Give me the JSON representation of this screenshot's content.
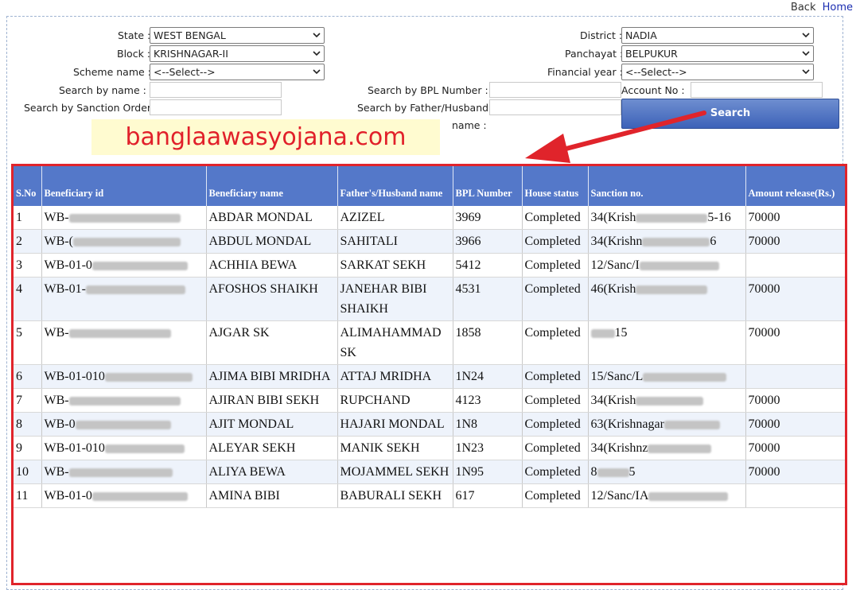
{
  "nav": {
    "back": "Back",
    "home": "Home"
  },
  "filters": {
    "state_label": "State :",
    "state_value": "WEST BENGAL",
    "block_label": "Block :",
    "block_value": "KRISHNAGAR-II",
    "scheme_label": "Scheme name :",
    "scheme_value": "<--Select-->",
    "search_name_label": "Search by name :",
    "search_sanction_label": "Search by Sanction Order",
    "district_label": "District :",
    "district_value": "NADIA",
    "panchayat_label": "Panchayat :",
    "panchayat_value": "BELPUKUR",
    "fy_label": "Financial year :",
    "fy_value": "<--Select-->",
    "bpl_label": "Search by BPL Number :",
    "father_label_1": "Search by Father/Husband",
    "father_label_2": "name :",
    "account_label": "Account No :",
    "search_button": "Search"
  },
  "watermark": "banglaawasyojana.com",
  "table": {
    "headers": [
      "S.No",
      "Beneficiary id",
      "Beneficiary name",
      "Father's/Husband name",
      "BPL Number",
      "House status",
      "Sanction no.",
      "Amount release(Rs.)"
    ],
    "rows": [
      {
        "sno": "1",
        "id": "WB-",
        "name": "ABDAR MONDAL",
        "father": "AZIZEL",
        "bpl": "3969",
        "status": "Completed",
        "sanction": "34(Krish",
        "sanction_end": "5-16",
        "amount": "70000"
      },
      {
        "sno": "2",
        "id": "WB-(",
        "name": "ABDUL MONDAL",
        "father": "SAHITALI",
        "bpl": "3966",
        "status": "Completed",
        "sanction": "34(Krishn",
        "sanction_end": "6",
        "amount": "70000"
      },
      {
        "sno": "3",
        "id": "WB-01-0",
        "name": "ACHHIA BEWA",
        "father": "SARKAT SEKH",
        "bpl": "5412",
        "status": "Completed",
        "sanction": "12/Sanc/I",
        "sanction_end": "",
        "amount": ""
      },
      {
        "sno": "4",
        "id": "WB-01-",
        "name": "AFOSHOS SHAIKH",
        "father": "JANEHAR BIBI SHAIKH",
        "bpl": "4531",
        "status": "Completed",
        "sanction": "46(Krish",
        "sanction_end": "",
        "amount": "70000"
      },
      {
        "sno": "5",
        "id": "WB-",
        "name": "AJGAR SK",
        "father": "ALIMAHAMMAD SK",
        "bpl": "1858",
        "status": "Completed",
        "sanction": "",
        "sanction_end": "15",
        "amount": "70000"
      },
      {
        "sno": "6",
        "id": "WB-01-010",
        "name": "AJIMA BIBI MRIDHA",
        "father": "ATTAJ MRIDHA",
        "bpl": "1N24",
        "status": "Completed",
        "sanction": "15/Sanc/L",
        "sanction_end": "",
        "amount": ""
      },
      {
        "sno": "7",
        "id": "WB-",
        "name": "AJIRAN BIBI SEKH",
        "father": "RUPCHAND",
        "bpl": "4123",
        "status": "Completed",
        "sanction": "34(Krish",
        "sanction_end": "",
        "amount": "70000"
      },
      {
        "sno": "8",
        "id": "WB-0",
        "name": "AJIT MONDAL",
        "father": "HAJARI MONDAL",
        "bpl": "1N8",
        "status": "Completed",
        "sanction": "63(Krishnagar",
        "sanction_end": "",
        "amount": "70000"
      },
      {
        "sno": "9",
        "id": "WB-01-010",
        "name": "ALEYAR SEKH",
        "father": "MANIK SEKH",
        "bpl": "1N23",
        "status": "Completed",
        "sanction": "34(Krishnz",
        "sanction_end": "",
        "amount": "70000"
      },
      {
        "sno": "10",
        "id": "WB-",
        "name": "ALIYA BEWA",
        "father": "MOJAMMEL SEKH",
        "bpl": "1N95",
        "status": "Completed",
        "sanction": "8",
        "sanction_end": "5",
        "amount": "70000"
      },
      {
        "sno": "11",
        "id": "WB-01-0",
        "name": "AMINA BIBI",
        "father": "BABURALI SEKH",
        "bpl": "617",
        "status": "Completed",
        "sanction": "12/Sanc/IA",
        "sanction_end": "",
        "amount": ""
      }
    ]
  },
  "colors": {
    "header_bg": "#5478c9",
    "highlight_border": "#e0242b",
    "watermark_text": "#e1202a",
    "button_bg": "#4a6fc2"
  }
}
